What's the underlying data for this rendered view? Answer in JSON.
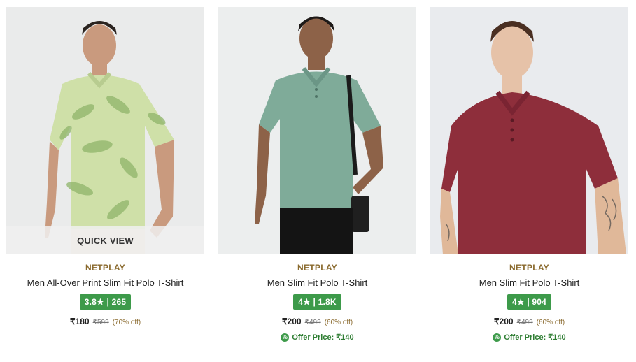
{
  "products": [
    {
      "brand": "NETPLAY",
      "title": "Men All-Over Print Slim Fit Polo T-Shirt",
      "rating": "3.8★ | 265",
      "price": "₹180",
      "mrp": "₹599",
      "discount": "(70% off)",
      "quick_view": "QUICK VIEW",
      "shirt_color": "#cfe0a8",
      "bg_color": "#e3e4e4"
    },
    {
      "brand": "NETPLAY",
      "title": "Men Slim Fit Polo T-Shirt",
      "rating": "4★ | 1.8K",
      "price": "₹200",
      "mrp": "₹499",
      "discount": "(60% off)",
      "offer_price": "Offer Price: ₹140",
      "shirt_color": "#7fab99",
      "bg_color": "#eceeee"
    },
    {
      "brand": "NETPLAY",
      "title": "Men Slim Fit Polo T-Shirt",
      "rating": "4★ | 904",
      "price": "₹200",
      "mrp": "₹499",
      "discount": "(60% off)",
      "offer_price": "Offer Price: ₹140",
      "shirt_color": "#8e2e3b",
      "bg_color": "#e9ebee"
    }
  ],
  "colors": {
    "brand_text": "#8a6a2e",
    "rating_bg": "#3d9a4a",
    "offer_text": "#2e7d32"
  }
}
